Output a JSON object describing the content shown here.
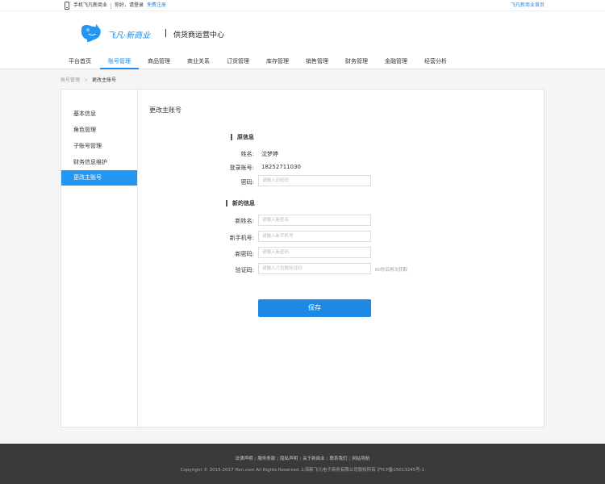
{
  "topbar": {
    "mobile_text": "手机飞凡新商业",
    "greeting": "你好，请登录",
    "register": "免费注册",
    "home_link": "飞凡新商业首页"
  },
  "header": {
    "logo_text": "飞凡·新商业",
    "title": "供货商运营中心"
  },
  "nav": {
    "items": [
      {
        "label": "平台首页"
      },
      {
        "label": "账号管理"
      },
      {
        "label": "商品管理"
      },
      {
        "label": "商业关系"
      },
      {
        "label": "订货管理"
      },
      {
        "label": "库存管理"
      },
      {
        "label": "销售管理"
      },
      {
        "label": "财务管理"
      },
      {
        "label": "金融管理"
      },
      {
        "label": "经营分析"
      }
    ],
    "active": "账号管理"
  },
  "breadcrumb": {
    "parent": "账号管理",
    "arrow": ">",
    "current": "更改主账号"
  },
  "sidebar": {
    "items": [
      {
        "label": "基本信息"
      },
      {
        "label": "角色管理"
      },
      {
        "label": "子账号管理"
      },
      {
        "label": "财务信息维护"
      },
      {
        "label": "更改主账号"
      }
    ],
    "active": "更改主账号"
  },
  "page_title": "更改主账号",
  "original": {
    "section_title": "原信息",
    "name_label": "姓名:",
    "name_value": "沈梦婷",
    "account_label": "登录账号:",
    "account_value": "18252711030",
    "password_label": "密码:",
    "password_placeholder": "请输入旧密码"
  },
  "new_info": {
    "section_title": "新的信息",
    "name_label": "新姓名:",
    "name_placeholder": "请输入新姓名",
    "phone_label": "新手机号:",
    "phone_placeholder": "请输入新手机号",
    "password_label": "新密码:",
    "password_placeholder": "请输入新密码",
    "code_label": "验证码:",
    "code_placeholder": "请输入六位数验证码",
    "code_hint": "60秒后再次获取"
  },
  "save_label": "保存",
  "footer": {
    "links": [
      {
        "label": "法律声明"
      },
      {
        "label": "服务条款"
      },
      {
        "label": "隐私声明"
      },
      {
        "label": "关于新商业"
      },
      {
        "label": "联系我们"
      },
      {
        "label": "网站导航"
      }
    ],
    "link_separator": "|",
    "copyright": "Copyright © 2015-2017 ffan.com All Rights Reserved 上海新飞凡电子商务有限公司版权所有 沪ICP备15013245号-1"
  },
  "colors": {
    "accent": "#1e88e5",
    "footer_bg": "#3a3a3a"
  }
}
